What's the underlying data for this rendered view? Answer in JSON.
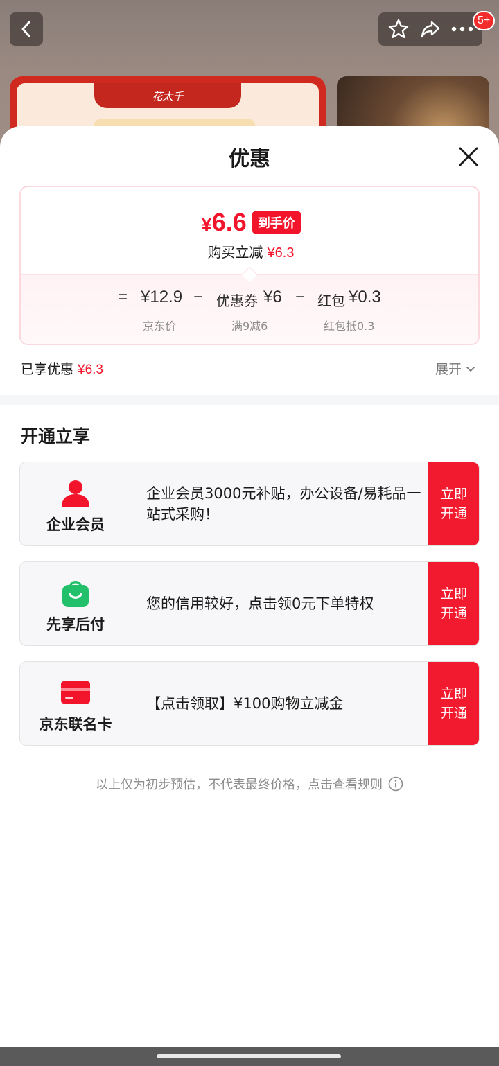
{
  "background": {
    "badge_count": "5+",
    "product_left_tag": "花太千"
  },
  "sheet": {
    "title": "优惠"
  },
  "price_card": {
    "final_price_symbol": "¥",
    "final_price": "6.6",
    "final_price_tag": "到手价",
    "discount_text": "购买立减",
    "discount_value": "¥6.3",
    "breakdown": {
      "equals": "=",
      "minus": "−",
      "items": [
        {
          "value": "¥12.9",
          "prefix": "",
          "label": "京东价"
        },
        {
          "value": "¥6",
          "prefix": "优惠券",
          "label": "满9减6"
        },
        {
          "value": "¥0.3",
          "prefix": "红包",
          "label": "红包抵0.3"
        }
      ]
    }
  },
  "enjoyed": {
    "label": "已享优惠",
    "value": "¥6.3",
    "expand_label": "展开"
  },
  "section": {
    "title": "开通立享"
  },
  "offers": [
    {
      "name": "企业会员",
      "icon": "person-icon",
      "description": " 企业会员3000元补贴，办公设备/易耗品一站式采购！",
      "button_line1": "立即",
      "button_line2": "开通"
    },
    {
      "name": "先享后付",
      "icon": "shopping-bag-icon",
      "description": "您的信用较好，点击领0元下单特权",
      "button_line1": "立即",
      "button_line2": "开通"
    },
    {
      "name": "京东联名卡",
      "icon": "credit-card-icon",
      "description": "【点击领取】¥100购物立减金",
      "button_line1": "立即",
      "button_line2": "开通"
    }
  ],
  "footer_note": "以上仅为初步预估，不代表最终价格，点击查看规则",
  "colors": {
    "accent_red": "#f2142b",
    "green": "#22c06a",
    "button_red": "#f21a2e"
  }
}
